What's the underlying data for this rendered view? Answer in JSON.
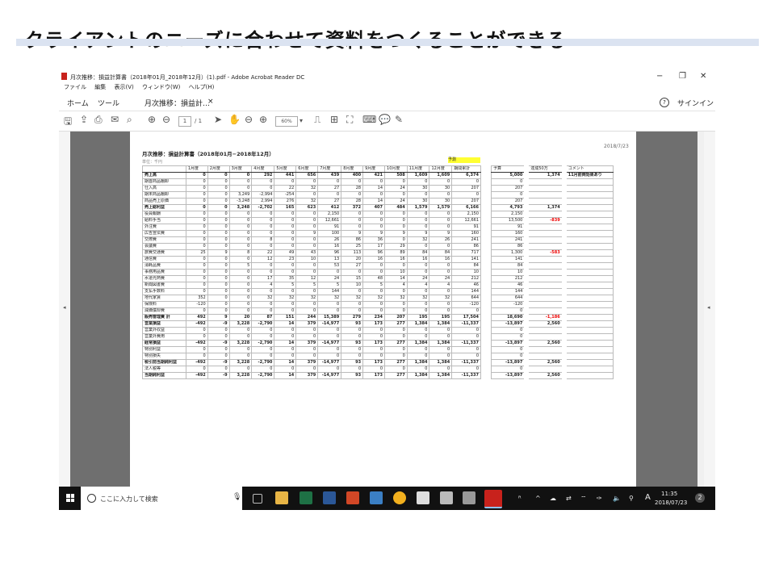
{
  "slide_title": "クライアントのニーズに合わせて資料をつくることができる",
  "window": {
    "title": "月次推移：損益計算書（2018年01月_2018年12月）(1).pdf - Adobe Acrobat Reader DC",
    "controls": {
      "minimize": "−",
      "restore": "❐",
      "close": "✕"
    }
  },
  "menu": [
    "ファイル",
    "編集",
    "表示(V)",
    "ウィンドウ(W)",
    "ヘルプ(H)"
  ],
  "tabs": {
    "home": "ホーム",
    "tools": "ツール",
    "doc": "月次推移：損益計…",
    "doc_close": "×",
    "signin": "サインイン",
    "help": "?"
  },
  "toolbar": {
    "page_current": "1",
    "page_total": "/ 1",
    "zoom": "60%"
  },
  "report": {
    "date": "2018/7/23",
    "title": "月次推移：損益計算書（2018年01月−2018年12月）",
    "sub": "単位：千円",
    "forecast_label": "予測",
    "headers": [
      "",
      "1月度",
      "2月度",
      "3月度",
      "4月度",
      "5月度",
      "6月度",
      "7月度",
      "8月度",
      "9月度",
      "10月度",
      "11月度",
      "12月度",
      "期間累計"
    ],
    "side_headers": [
      "予算",
      "達成50万",
      "コメント"
    ],
    "rows": [
      {
        "label": "売上高",
        "bold": true,
        "values": [
          "0",
          "0",
          "0",
          "292",
          "441",
          "656",
          "439",
          "400",
          "421",
          "508",
          "1,609",
          "1,609",
          "6,374"
        ],
        "budget": "5,000",
        "diff": "1,374",
        "comment": "11月前倒効果あり"
      },
      {
        "label": "期首商品棚卸",
        "values": [
          "0",
          "0",
          "0",
          "0",
          "0",
          "0",
          "0",
          "0",
          "0",
          "0",
          "0",
          "0",
          "0"
        ],
        "budget": "0",
        "diff": "",
        "comment": ""
      },
      {
        "label": "仕入高",
        "values": [
          "0",
          "0",
          "0",
          "0",
          "22",
          "32",
          "27",
          "28",
          "14",
          "24",
          "30",
          "30",
          "207"
        ],
        "budget": "207",
        "diff": "",
        "comment": ""
      },
      {
        "label": "期末商品棚卸",
        "values": [
          "0",
          "0",
          "3,249",
          "-2,994",
          "-254",
          "0",
          "0",
          "0",
          "0",
          "0",
          "0",
          "0",
          "0"
        ],
        "budget": "0",
        "diff": "",
        "comment": ""
      },
      {
        "label": "商品売上原価",
        "values": [
          "0",
          "0",
          "-3,248",
          "2,994",
          "276",
          "32",
          "27",
          "28",
          "14",
          "24",
          "30",
          "30",
          "207"
        ],
        "budget": "207",
        "diff": "",
        "comment": ""
      },
      {
        "label": "売上総利益",
        "bold": true,
        "values": [
          "0",
          "0",
          "3,248",
          "-2,702",
          "165",
          "623",
          "412",
          "372",
          "407",
          "484",
          "1,579",
          "1,579",
          "6,166"
        ],
        "budget": "4,793",
        "diff": "1,374",
        "comment": ""
      },
      {
        "label": "役員報酬",
        "values": [
          "0",
          "0",
          "0",
          "0",
          "0",
          "0",
          "2,150",
          "0",
          "0",
          "0",
          "0",
          "0",
          "2,150"
        ],
        "budget": "2,150",
        "diff": "",
        "comment": ""
      },
      {
        "label": "給料手当",
        "values": [
          "0",
          "0",
          "0",
          "0",
          "0",
          "0",
          "12,661",
          "0",
          "0",
          "0",
          "0",
          "0",
          "12,661"
        ],
        "budget": "13,500",
        "diff": "-839",
        "diff_red": true,
        "comment": ""
      },
      {
        "label": "外注費",
        "values": [
          "0",
          "0",
          "0",
          "0",
          "0",
          "0",
          "91",
          "0",
          "0",
          "0",
          "0",
          "0",
          "91"
        ],
        "budget": "91",
        "diff": "",
        "comment": ""
      },
      {
        "label": "広告宣伝費",
        "values": [
          "0",
          "0",
          "0",
          "0",
          "0",
          "9",
          "100",
          "9",
          "9",
          "9",
          "9",
          "9",
          "160"
        ],
        "budget": "160",
        "diff": "",
        "comment": ""
      },
      {
        "label": "交際費",
        "values": [
          "0",
          "0",
          "0",
          "8",
          "0",
          "0",
          "26",
          "86",
          "36",
          "0",
          "32",
          "26",
          "241"
        ],
        "budget": "241",
        "diff": "",
        "comment": ""
      },
      {
        "label": "会議費",
        "values": [
          "0",
          "0",
          "0",
          "0",
          "0",
          "0",
          "16",
          "25",
          "17",
          "29",
          "0",
          "0",
          "86"
        ],
        "budget": "86",
        "diff": "",
        "comment": ""
      },
      {
        "label": "旅費交通費",
        "values": [
          "25",
          "9",
          "8",
          "22",
          "49",
          "43",
          "96",
          "113",
          "96",
          "89",
          "84",
          "84",
          "717"
        ],
        "budget": "1,300",
        "diff": "-583",
        "diff_red": true,
        "comment": ""
      },
      {
        "label": "通信費",
        "values": [
          "0",
          "0",
          "0",
          "12",
          "23",
          "10",
          "13",
          "20",
          "16",
          "16",
          "16",
          "16",
          "141"
        ],
        "budget": "141",
        "diff": "",
        "comment": ""
      },
      {
        "label": "消耗品費",
        "values": [
          "0",
          "0",
          "5",
          "0",
          "0",
          "0",
          "53",
          "27",
          "0",
          "0",
          "0",
          "0",
          "84"
        ],
        "budget": "84",
        "diff": "",
        "comment": ""
      },
      {
        "label": "事務用品費",
        "values": [
          "0",
          "0",
          "0",
          "0",
          "0",
          "0",
          "0",
          "0",
          "0",
          "10",
          "0",
          "0",
          "10"
        ],
        "budget": "10",
        "diff": "",
        "comment": ""
      },
      {
        "label": "水道光熱費",
        "values": [
          "0",
          "0",
          "0",
          "17",
          "35",
          "12",
          "24",
          "15",
          "48",
          "14",
          "24",
          "24",
          "212"
        ],
        "budget": "212",
        "diff": "",
        "comment": ""
      },
      {
        "label": "新聞図書費",
        "values": [
          "0",
          "0",
          "0",
          "4",
          "5",
          "5",
          "5",
          "10",
          "5",
          "4",
          "4",
          "4",
          "46"
        ],
        "budget": "46",
        "diff": "",
        "comment": ""
      },
      {
        "label": "支払手数料",
        "values": [
          "0",
          "0",
          "0",
          "0",
          "0",
          "0",
          "144",
          "0",
          "0",
          "0",
          "0",
          "0",
          "144"
        ],
        "budget": "144",
        "diff": "",
        "comment": ""
      },
      {
        "label": "地代家賃",
        "values": [
          "352",
          "0",
          "0",
          "32",
          "32",
          "32",
          "32",
          "32",
          "32",
          "32",
          "32",
          "32",
          "644"
        ],
        "budget": "644",
        "diff": "",
        "comment": ""
      },
      {
        "label": "保険料",
        "values": [
          "-120",
          "0",
          "0",
          "0",
          "0",
          "0",
          "0",
          "0",
          "0",
          "0",
          "0",
          "0",
          "-120"
        ],
        "budget": "-120",
        "diff": "",
        "comment": ""
      },
      {
        "label": "減価償却費",
        "values": [
          "0",
          "0",
          "0",
          "0",
          "0",
          "0",
          "0",
          "0",
          "0",
          "0",
          "0",
          "0",
          "0"
        ],
        "budget": "0",
        "diff": "",
        "comment": ""
      },
      {
        "label": "販売管理費 計",
        "bold": true,
        "values": [
          "492",
          "9",
          "20",
          "87",
          "151",
          "244",
          "15,389",
          "279",
          "234",
          "207",
          "195",
          "195",
          "17,504"
        ],
        "budget": "18,690",
        "diff": "-1,186",
        "diff_red": true,
        "comment": ""
      },
      {
        "label": "営業損益",
        "bold": true,
        "values": [
          "-492",
          "-9",
          "3,228",
          "-2,790",
          "14",
          "379",
          "-14,977",
          "93",
          "173",
          "277",
          "1,384",
          "1,384",
          "-11,337"
        ],
        "budget": "-13,897",
        "diff": "2,560",
        "comment": ""
      },
      {
        "label": "営業外収益",
        "values": [
          "0",
          "0",
          "0",
          "0",
          "0",
          "0",
          "0",
          "0",
          "0",
          "0",
          "0",
          "0",
          "0"
        ],
        "budget": "0",
        "diff": "",
        "comment": ""
      },
      {
        "label": "営業外費用",
        "values": [
          "0",
          "0",
          "0",
          "0",
          "0",
          "0",
          "0",
          "0",
          "0",
          "0",
          "0",
          "0",
          "0"
        ],
        "budget": "0",
        "diff": "",
        "comment": ""
      },
      {
        "label": "経常損益",
        "bold": true,
        "values": [
          "-492",
          "-9",
          "3,228",
          "-2,790",
          "14",
          "379",
          "-14,977",
          "93",
          "173",
          "277",
          "1,384",
          "1,384",
          "-11,337"
        ],
        "budget": "-13,897",
        "diff": "2,560",
        "comment": ""
      },
      {
        "label": "特別利益",
        "values": [
          "0",
          "0",
          "0",
          "0",
          "0",
          "0",
          "0",
          "0",
          "0",
          "0",
          "0",
          "0",
          "0"
        ],
        "budget": "0",
        "diff": "",
        "comment": ""
      },
      {
        "label": "特別損失",
        "values": [
          "0",
          "0",
          "0",
          "0",
          "0",
          "0",
          "0",
          "0",
          "0",
          "0",
          "0",
          "0",
          "0"
        ],
        "budget": "0",
        "diff": "",
        "comment": ""
      },
      {
        "label": "税引前当期純利益",
        "bold": true,
        "values": [
          "-492",
          "-9",
          "3,228",
          "-2,790",
          "14",
          "379",
          "-14,977",
          "93",
          "173",
          "277",
          "1,384",
          "1,384",
          "-11,337"
        ],
        "budget": "-13,897",
        "diff": "2,560",
        "comment": ""
      },
      {
        "label": "法人税等",
        "values": [
          "0",
          "0",
          "0",
          "0",
          "0",
          "0",
          "0",
          "0",
          "0",
          "0",
          "0",
          "0",
          "0"
        ],
        "budget": "0",
        "diff": "",
        "comment": ""
      },
      {
        "label": "当期純利益",
        "bold": true,
        "values": [
          "-492",
          "-9",
          "3,228",
          "-2,790",
          "14",
          "379",
          "-14,977",
          "93",
          "173",
          "277",
          "1,384",
          "1,384",
          "-11,337"
        ],
        "budget": "-13,897",
        "diff": "2,560",
        "comment": ""
      }
    ]
  },
  "taskbar": {
    "search_placeholder": "ここに入力して検索",
    "time": "11:35",
    "date": "2018/07/23",
    "ime": "A",
    "notifications": "2"
  }
}
